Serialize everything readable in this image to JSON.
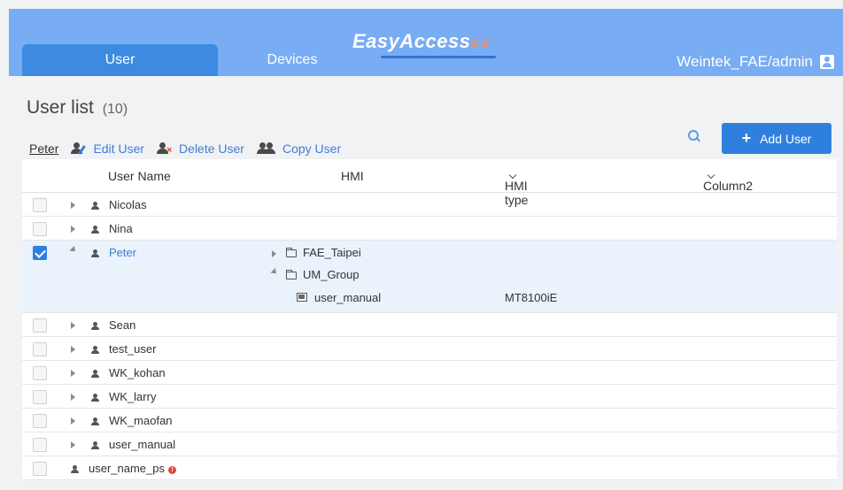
{
  "header": {
    "brand": "EasyAccess",
    "brand_version": "2.0",
    "tabs": [
      {
        "label": "User",
        "active": true
      },
      {
        "label": "Devices",
        "active": false
      }
    ],
    "account": "Weintek_FAE/admin"
  },
  "page": {
    "title": "User list",
    "count": "(10)"
  },
  "toolbar": {
    "selected": "Peter",
    "edit": "Edit User",
    "delete": "Delete User",
    "copy": "Copy User",
    "add": "Add User"
  },
  "table": {
    "columns": [
      "User Name",
      "HMI",
      "HMI type",
      "Column2"
    ],
    "rows": [
      {
        "name": "Nicolas",
        "checked": false
      },
      {
        "name": "Nina",
        "checked": false
      },
      {
        "name": "Peter",
        "checked": true,
        "expanded": true,
        "groups": [
          "FAE_Taipei",
          "UM_Group"
        ],
        "device": {
          "name": "user_manual",
          "type": "MT8100iE"
        }
      },
      {
        "name": "Sean",
        "checked": false
      },
      {
        "name": "test_user",
        "checked": false
      },
      {
        "name": "WK_kohan",
        "checked": false
      },
      {
        "name": "WK_larry",
        "checked": false
      },
      {
        "name": "WK_maofan",
        "checked": false
      },
      {
        "name": "user_manual",
        "checked": false
      },
      {
        "name": "user_name_ps",
        "checked": false,
        "warning": true
      }
    ]
  },
  "colors": {
    "header_bg": "#78acf3",
    "active_tab": "#3d8ae0",
    "accent": "#2f80de",
    "link": "#3d7fd6",
    "expanded_row": "#eaf2fb"
  }
}
